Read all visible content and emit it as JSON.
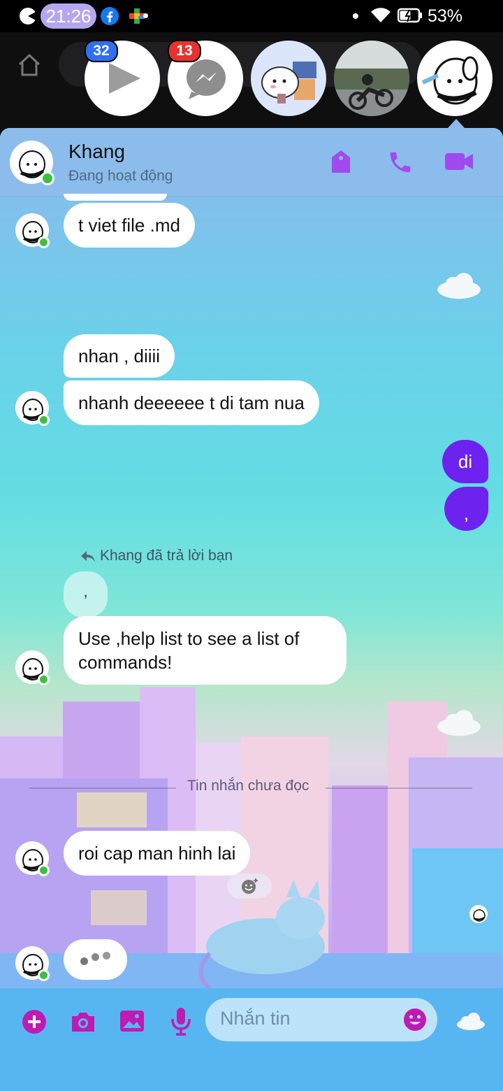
{
  "status_bar": {
    "time": "21:26",
    "battery": "53%"
  },
  "chat_heads": {
    "badges": [
      "32",
      "13"
    ]
  },
  "contact": {
    "name": "Khang",
    "status": "Đang hoạt động"
  },
  "messages": {
    "m1": "t viet file .md",
    "m2": "nhan , diiii",
    "m3": "nhanh deeeeee t di tam nua",
    "my1": "di",
    "my2": ",",
    "reply_notice": "Khang đã trả lời bạn",
    "reply_quote": ",",
    "m4_line1": "Use ,help list to see a list of",
    "m4_line2": "commands!",
    "unread_divider": "Tin nhắn chưa đọc",
    "m5": "roi cap man hinh lai"
  },
  "composer": {
    "placeholder": "Nhắn tin"
  },
  "colors": {
    "accent": "#6d22f0",
    "header_icons": "#a04af0",
    "composer_icons": "#c01ab4",
    "online": "#3fbf3f"
  }
}
